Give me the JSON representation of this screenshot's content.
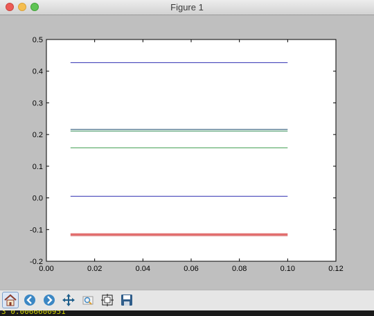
{
  "window": {
    "title": "Figure 1"
  },
  "toolbar": {
    "buttons": [
      {
        "name": "home-button",
        "icon": "home-icon"
      },
      {
        "name": "back-button",
        "icon": "back-arrow-icon"
      },
      {
        "name": "forward-button",
        "icon": "forward-arrow-icon"
      },
      {
        "name": "pan-button",
        "icon": "move-arrows-icon"
      },
      {
        "name": "zoom-button",
        "icon": "zoom-rect-icon"
      },
      {
        "name": "configure-subplots-button",
        "icon": "subplots-icon"
      },
      {
        "name": "save-button",
        "icon": "save-disk-icon"
      }
    ]
  },
  "terminal": {
    "text": "3  0.0066600951"
  },
  "chart_data": {
    "type": "line",
    "x": [
      0.01,
      0.1
    ],
    "xlim": [
      0.0,
      0.12
    ],
    "ylim": [
      -0.2,
      0.5
    ],
    "xticks": [
      "0.00",
      "0.02",
      "0.04",
      "0.06",
      "0.08",
      "0.10",
      "0.12"
    ],
    "yticks": [
      "-0.2",
      "-0.1",
      "0.0",
      "0.1",
      "0.2",
      "0.3",
      "0.4",
      "0.5"
    ],
    "grid": false,
    "series": [
      {
        "values": [
          0.427,
          0.427
        ],
        "color": "#2b2bb0"
      },
      {
        "values": [
          0.216,
          0.216
        ],
        "color": "#1c4f6e"
      },
      {
        "values": [
          0.211,
          0.211
        ],
        "color": "#2e8a55"
      },
      {
        "values": [
          0.158,
          0.158
        ],
        "color": "#3a9a4a"
      },
      {
        "values": [
          0.005,
          0.005
        ],
        "color": "#2b2bb0"
      },
      {
        "values": [
          -0.113,
          -0.113
        ],
        "color": "#d94040"
      },
      {
        "values": [
          -0.116,
          -0.116
        ],
        "color": "#e05050"
      },
      {
        "values": [
          -0.119,
          -0.119
        ],
        "color": "#c93030"
      }
    ]
  }
}
